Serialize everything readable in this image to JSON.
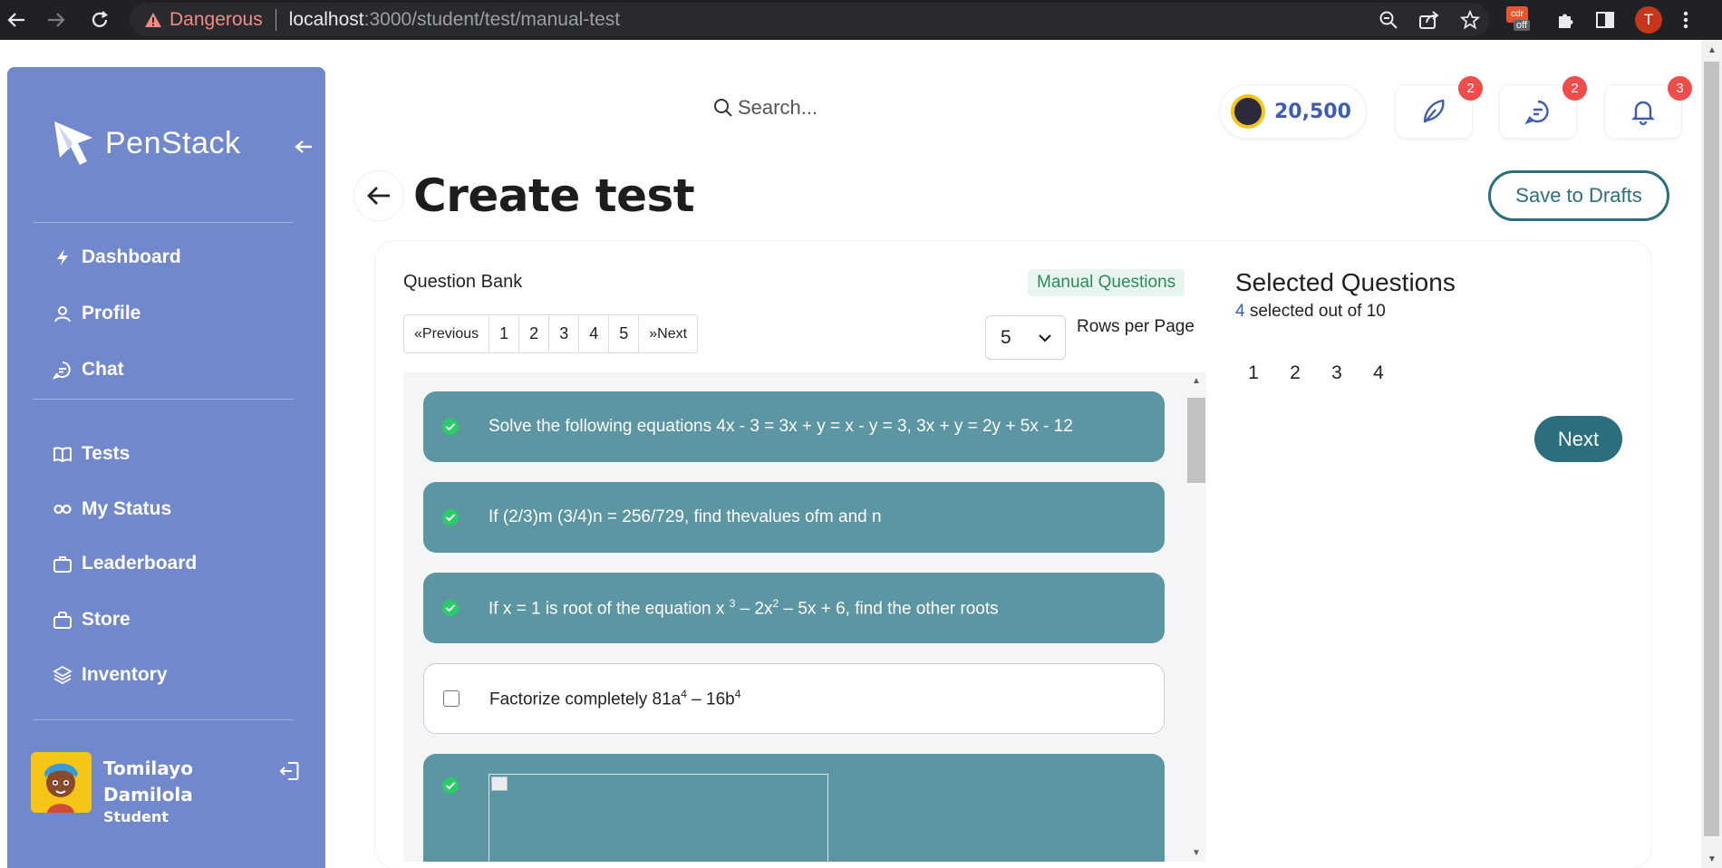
{
  "browser": {
    "security_label": "Dangerous",
    "url_host": "localhost",
    "url_path": ":3000/student/test/manual-test",
    "ext_off_label": "off",
    "ext_top_label": "cdr",
    "profile_initial": "T"
  },
  "sidebar": {
    "logo": "PenStack",
    "items": [
      {
        "label": "Dashboard",
        "icon": "bolt-icon"
      },
      {
        "label": "Profile",
        "icon": "user-icon"
      },
      {
        "label": "Chat",
        "icon": "chat-icon"
      },
      {
        "label": "Tests",
        "icon": "book-icon"
      },
      {
        "label": "My Status",
        "icon": "infinity-icon"
      },
      {
        "label": "Leaderboard",
        "icon": "briefcase-icon"
      },
      {
        "label": "Store",
        "icon": "bag-icon"
      },
      {
        "label": "Inventory",
        "icon": "layers-icon"
      }
    ],
    "user": {
      "first": "Tomilayo",
      "last": "Damilola",
      "role": "Student"
    }
  },
  "header": {
    "search_placeholder": "Search...",
    "coins": "20,500",
    "badges": {
      "quill": "2",
      "messages": "2",
      "notifications": "3"
    }
  },
  "page": {
    "title": "Create test",
    "save_drafts": "Save to Drafts"
  },
  "bank": {
    "label": "Question Bank",
    "tag": "Manual Questions",
    "pager": {
      "prev": "«Previous",
      "pages": [
        "1",
        "2",
        "3",
        "4",
        "5"
      ],
      "next": "»Next"
    },
    "rows_value": "5",
    "rows_label": "Rows per Page",
    "questions": [
      {
        "text": "Solve the following equations 4x - 3 = 3x + y = x - y = 3, 3x + y = 2y + 5x - 12",
        "selected": true
      },
      {
        "text": "If (2/3)m (3/4)n = 256/729, find thevalues ofm and n",
        "selected": true
      },
      {
        "text_a": "If x = 1 is root of the equation x ",
        "sup_a": "3",
        "text_b": " – 2x",
        "sup_b": "2",
        "text_c": " – 5x + 6, find the other roots",
        "selected": true
      },
      {
        "text_a": "Factorize completely 81a",
        "sup_a": "4",
        "text_b": " – 16b",
        "sup_b": "4",
        "selected": false
      },
      {
        "image": true,
        "selected": true
      }
    ]
  },
  "selected_panel": {
    "title": "Selected Questions",
    "count": "4",
    "count_suffix": " selected out of 10",
    "numbers": [
      "1",
      "2",
      "3",
      "4"
    ],
    "next": "Next"
  },
  "colors": {
    "sidebar": "#7189cc",
    "teal": "#2b6f7e",
    "selected_row": "#5b96a2",
    "coin_text": "#3d5db4",
    "badge": "#ef4c4c"
  }
}
